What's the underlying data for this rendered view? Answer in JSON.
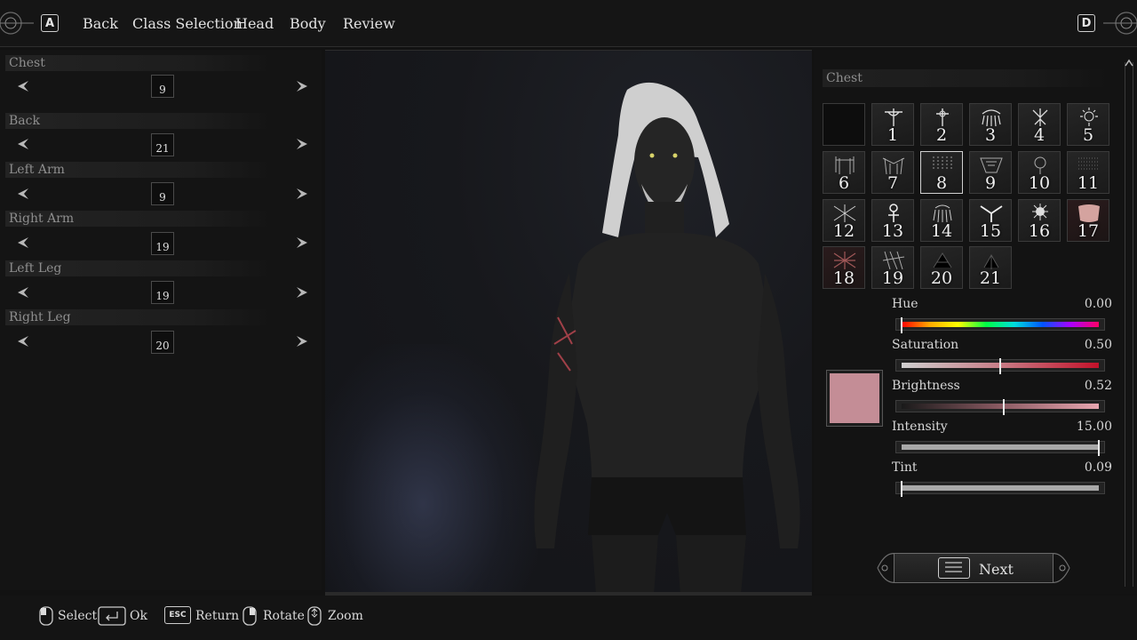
{
  "topnav": {
    "key_left": "A",
    "key_right": "D",
    "items": [
      "Back",
      "Class Selection",
      "Head",
      "Body",
      "Review"
    ]
  },
  "left_panel": {
    "slots": [
      {
        "label": "Chest",
        "value": "9"
      },
      {
        "label": "Back",
        "value": "21"
      },
      {
        "label": "Left Arm",
        "value": "9"
      },
      {
        "label": "Right Arm",
        "value": "19"
      },
      {
        "label": "Left Leg",
        "value": "19"
      },
      {
        "label": "Right Leg",
        "value": "20"
      }
    ]
  },
  "right_panel": {
    "title": "Chest",
    "tiles": [
      "",
      "1",
      "2",
      "3",
      "4",
      "5",
      "6",
      "7",
      "8",
      "9",
      "10",
      "11",
      "12",
      "13",
      "14",
      "15",
      "16",
      "17",
      "18",
      "19",
      "20",
      "21"
    ],
    "selected_tile": "8",
    "sliders": [
      {
        "label": "Hue",
        "value": "0.00",
        "level": 0.0
      },
      {
        "label": "Saturation",
        "value": "0.50",
        "level": 0.5
      },
      {
        "label": "Brightness",
        "value": "0.52",
        "level": 0.52
      },
      {
        "label": "Intensity",
        "value": "15.00",
        "level": 1.0
      },
      {
        "label": "Tint",
        "value": "0.09",
        "level": 0.0
      }
    ],
    "swatch_color": "#c48d96",
    "next_label": "Next"
  },
  "bottom_hints": {
    "select": "Select",
    "ok": "Ok",
    "esc_key": "ESC",
    "return": "Return",
    "rotate": "Rotate",
    "zoom": "Zoom"
  }
}
